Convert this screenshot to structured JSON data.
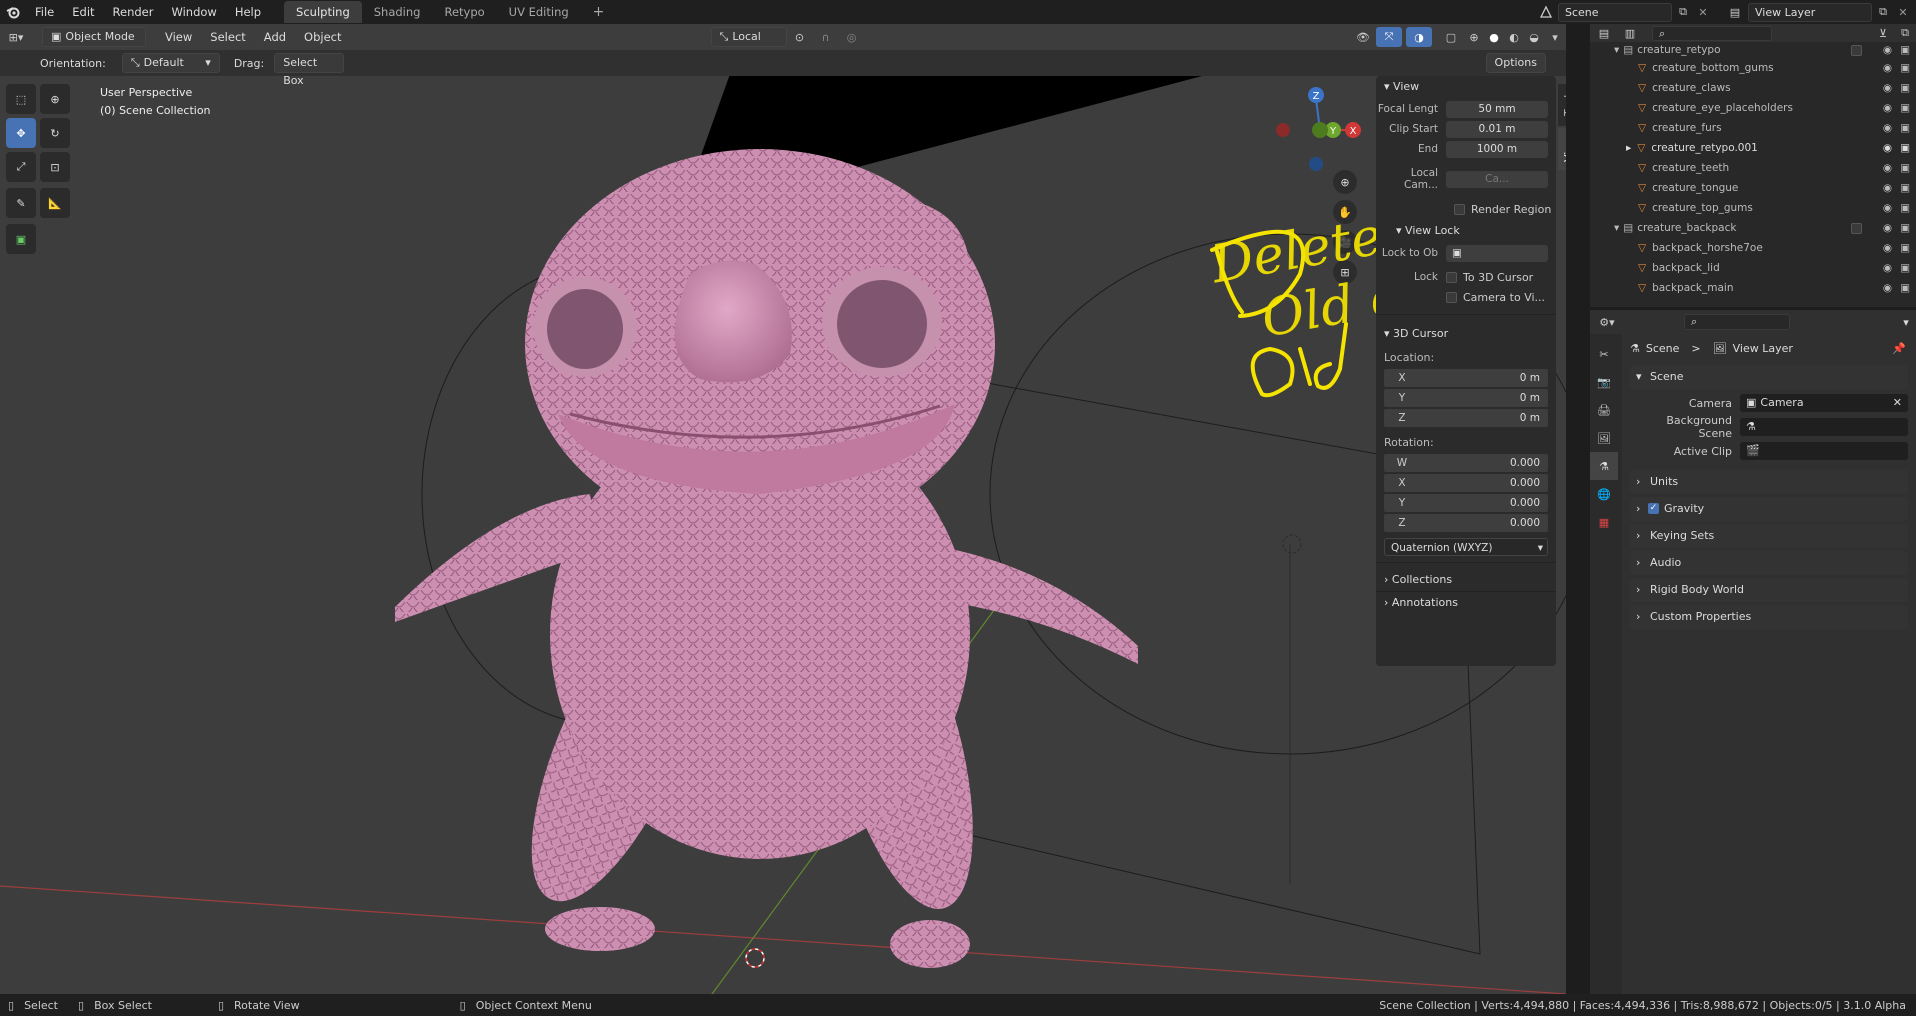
{
  "topbar": {
    "menus": [
      "File",
      "Edit",
      "Render",
      "Window",
      "Help"
    ],
    "workspaces": [
      "Sculpting",
      "Shading",
      "Retypo",
      "UV Editing"
    ],
    "active_workspace": "Sculpting",
    "add_workspace": "+",
    "scene_name": "Scene",
    "view_layer": "View Layer"
  },
  "viewport_header": {
    "mode": "Object Mode",
    "menus": [
      "View",
      "Select",
      "Add",
      "Object"
    ],
    "transform_orientation": "Local",
    "options": "Options"
  },
  "tool_header": {
    "orientation_label": "Orientation:",
    "orientation_value": "Default",
    "drag_label": "Drag:",
    "drag_value": "Select Box"
  },
  "viewport": {
    "perspective_label": "User Perspective",
    "collection_label": "(0) Scene Collection",
    "annotation_line1": "Delete the",
    "annotation_line2": "Old one",
    "annotation_color": "#f5e400",
    "gizmo": {
      "z": "Z",
      "x": "X",
      "y": "Y"
    }
  },
  "npanel": {
    "tabs": [
      "Tool",
      "View"
    ],
    "view_section": "View",
    "focal_length_label": "Focal Lengt",
    "focal_length_value": "50 mm",
    "clip_start_label": "Clip Start",
    "clip_start_value": "0.01 m",
    "clip_end_label": "End",
    "clip_end_value": "1000 m",
    "local_camera_label": "Local Cam...",
    "local_camera_value": "Ca...",
    "render_region": "Render Region",
    "view_lock_section": "View Lock",
    "lock_to_object_label": "Lock to Ob",
    "lock_label": "Lock",
    "to_3d_cursor": "To 3D Cursor",
    "camera_to_view": "Camera to Vi...",
    "cursor_section": "3D Cursor",
    "location_label": "Location:",
    "location": [
      {
        "axis": "X",
        "value": "0 m"
      },
      {
        "axis": "Y",
        "value": "0 m"
      },
      {
        "axis": "Z",
        "value": "0 m"
      }
    ],
    "rotation_label": "Rotation:",
    "rotation": [
      {
        "axis": "W",
        "value": "0.000"
      },
      {
        "axis": "X",
        "value": "0.000"
      },
      {
        "axis": "Y",
        "value": "0.000"
      },
      {
        "axis": "Z",
        "value": "0.000"
      }
    ],
    "rotation_mode": "Quaternion (WXYZ)",
    "collections_section": "Collections",
    "annotations_section": "Annotations"
  },
  "outliner": {
    "groups": [
      {
        "name": "creature_retypo",
        "items": [
          "creature_bottom_gums",
          "creature_claws",
          "creature_eye_placeholders",
          "creature_furs",
          "creature_retypo.001",
          "creature_teeth",
          "creature_tongue",
          "creature_top_gums"
        ]
      },
      {
        "name": "creature_backpack",
        "items": [
          "backpack_horshe7oe",
          "backpack_lid",
          "backpack_main"
        ]
      }
    ]
  },
  "properties": {
    "breadcrumb_scene": "Scene",
    "breadcrumb_separator": ">",
    "breadcrumb_view_layer": "View Layer",
    "scene_section": "Scene",
    "camera_label": "Camera",
    "camera_value": "Camera",
    "background_scene_label": "Background Scene",
    "active_clip_label": "Active Clip",
    "sections": [
      "Units",
      "Gravity",
      "Keying Sets",
      "Audio",
      "Rigid Body World",
      "Custom Properties"
    ],
    "gravity_checked": true
  },
  "statusbar": {
    "select": "Select",
    "box_select": "Box Select",
    "rotate_view": "Rotate View",
    "context_menu": "Object Context Menu",
    "stats": "Scene Collection | Verts:4,494,880 | Faces:4,494,336 | Tris:8,988,672 | Objects:0/5 | 3.1.0 Alpha"
  }
}
